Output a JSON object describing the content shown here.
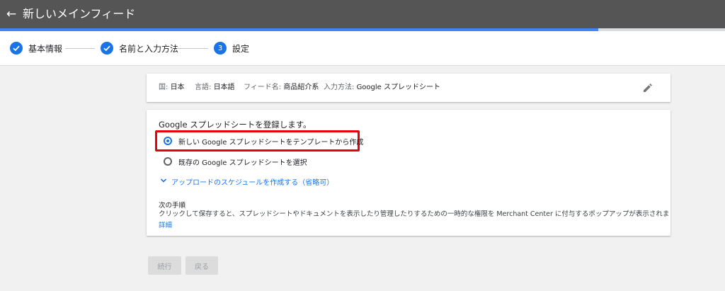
{
  "header": {
    "title": "新しいメインフィード",
    "progress_percent": 82.5
  },
  "stepper": {
    "steps": [
      {
        "label": "基本情報",
        "state": "complete"
      },
      {
        "label": "名前と入力方法",
        "state": "complete"
      },
      {
        "label": "設定",
        "number": "3",
        "state": "current"
      }
    ]
  },
  "summary": {
    "country_label": "国:",
    "country_value": "日本",
    "language_label": "言語:",
    "language_value": "日本語",
    "feed_name_label": "フィード名:",
    "feed_name_value": "商品紹介系",
    "input_method_label": "入力方法:",
    "input_method_value": "Google スプレッドシート"
  },
  "main": {
    "heading": "Google スプレッドシートを登録します。",
    "options": [
      {
        "label": "新しい Google スプレッドシートをテンプレートから作成",
        "checked": true
      },
      {
        "label": "既存の Google スプレッドシートを選択",
        "checked": false
      }
    ],
    "schedule_link": "アップロードのスケジュールを作成する（省略可）",
    "next_steps_title": "次の手順",
    "next_steps_body": "クリックして保存すると、スプレッドシートやドキュメントを表示したり管理したりするための一時的な権限を Merchant Center に付与するポップアップが表示されます。",
    "details_link": "詳細"
  },
  "buttons": {
    "continue": "続行",
    "back": "戻る"
  },
  "colors": {
    "accent": "#1a73e8",
    "topbar": "#555555",
    "highlight": "#e8000b"
  }
}
